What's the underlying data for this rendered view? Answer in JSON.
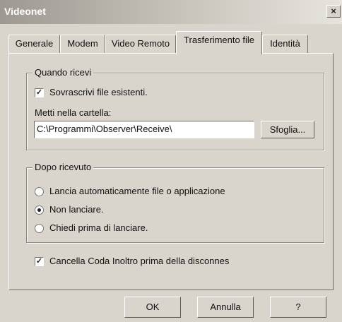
{
  "window": {
    "title": "Videonet",
    "close_label": "×"
  },
  "tabs": [
    "Generale",
    "Modem",
    "Video Remoto",
    "Trasferimento file",
    "Identità"
  ],
  "receive_group": {
    "title": "Quando ricevi",
    "overwrite_label": "Sovrascrivi file esistenti.",
    "overwrite_checked": true,
    "folder_label": "Metti nella cartella:",
    "folder_value": "C:\\Programmi\\Observer\\Receive\\",
    "browse_label": "Sfoglia..."
  },
  "after_group": {
    "title": "Dopo ricevuto",
    "options": [
      "Lancia automaticamente file o applicazione",
      "Non lanciare.",
      "Chiedi prima di lanciare."
    ],
    "selected_index": 1
  },
  "clear_queue": {
    "label": "Cancella Coda Inoltro prima della disconnes",
    "checked": true
  },
  "buttons": {
    "ok": "OK",
    "cancel": "Annulla",
    "help": "?"
  }
}
